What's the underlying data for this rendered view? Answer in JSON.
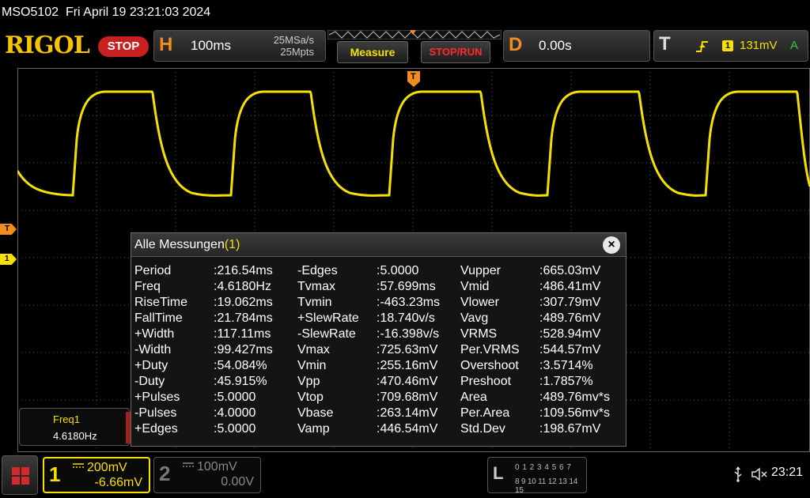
{
  "title_bar": {
    "model": "MSO5102",
    "datetime": "Fri April 19 23:21:03 2024"
  },
  "header": {
    "logo": "RIGOL",
    "run_state": "STOP",
    "horizontal": {
      "letter": "H",
      "timebase": "100ms",
      "sample_rate": "25MSa/s",
      "memory_depth": "25Mpts"
    },
    "measure_label": "Measure",
    "stoprun_label": "STOP/RUN",
    "delay": {
      "letter": "D",
      "value": "0.00s"
    },
    "trigger": {
      "letter": "T",
      "edge_icon": "rising-edge-icon",
      "source": "1",
      "level": "131mV",
      "mode": "A"
    }
  },
  "markers": {
    "trigger_level": "T",
    "ch1": "1",
    "trigger_position": "T"
  },
  "colors": {
    "ch1": "#f5e000",
    "accent_orange": "#f28c1c",
    "stop_red": "#c62020",
    "grid": "#555555"
  },
  "measurements": {
    "title": "Alle Messungen",
    "count": "(1)",
    "close": "×",
    "columns": [
      [
        {
          "name": "Period",
          "value": ":216.54ms"
        },
        {
          "name": "Freq",
          "value": ":4.6180Hz"
        },
        {
          "name": "RiseTime",
          "value": ":19.062ms"
        },
        {
          "name": "FallTime",
          "value": ":21.784ms"
        },
        {
          "name": "+Width",
          "value": ":117.11ms"
        },
        {
          "name": "-Width",
          "value": ":99.427ms"
        },
        {
          "name": "+Duty",
          "value": ":54.084%"
        },
        {
          "name": "-Duty",
          "value": ":45.915%"
        },
        {
          "name": "+Pulses",
          "value": ":5.0000"
        },
        {
          "name": "-Pulses",
          "value": ":4.0000"
        },
        {
          "name": "+Edges",
          "value": ":5.0000"
        }
      ],
      [
        {
          "name": "-Edges",
          "value": ":5.0000"
        },
        {
          "name": "Tvmax",
          "value": ":57.699ms"
        },
        {
          "name": "Tvmin",
          "value": ":-463.23ms"
        },
        {
          "name": "+SlewRate",
          "value": ":18.740v/s"
        },
        {
          "name": "-SlewRate",
          "value": ":-16.398v/s"
        },
        {
          "name": "Vmax",
          "value": ":725.63mV"
        },
        {
          "name": "Vmin",
          "value": ":255.16mV"
        },
        {
          "name": "Vpp",
          "value": ":470.46mV"
        },
        {
          "name": "Vtop",
          "value": ":709.68mV"
        },
        {
          "name": "Vbase",
          "value": ":263.14mV"
        },
        {
          "name": "Vamp",
          "value": ":446.54mV"
        }
      ],
      [
        {
          "name": "Vupper",
          "value": ":665.03mV"
        },
        {
          "name": "Vmid",
          "value": ":486.41mV"
        },
        {
          "name": "Vlower",
          "value": ":307.79mV"
        },
        {
          "name": "Vavg",
          "value": ":489.76mV"
        },
        {
          "name": "VRMS",
          "value": ":528.94mV"
        },
        {
          "name": "Per.VRMS",
          "value": ":544.57mV"
        },
        {
          "name": "Overshoot",
          "value": ":3.5714%"
        },
        {
          "name": "Preshoot",
          "value": ":1.7857%"
        },
        {
          "name": "Area",
          "value": ":489.76mv*s"
        },
        {
          "name": "Per.Area",
          "value": ":109.56mv*s"
        },
        {
          "name": "Std.Dev",
          "value": ":198.67mV"
        }
      ]
    ]
  },
  "stat_box": {
    "label": "Freq1",
    "value": "4.6180Hz"
  },
  "footer": {
    "ch1": {
      "number": "1",
      "coupling": "DC",
      "scale": "200mV",
      "offset": "-6.66mV"
    },
    "ch2": {
      "number": "2",
      "coupling": "DC",
      "scale": "100mV",
      "offset": "0.00V"
    },
    "la": {
      "letter": "L",
      "row1": "0 1 2 3   4 5 6 7",
      "row2": "8 9 10 11  12 13 14 15"
    },
    "clock": "23:21"
  }
}
